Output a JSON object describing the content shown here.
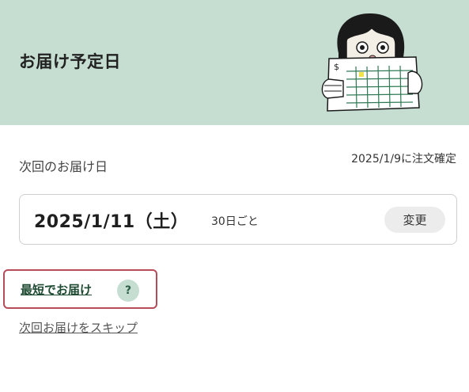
{
  "header": {
    "title": "お届け予定日"
  },
  "next_delivery": {
    "label": "次回のお届け日",
    "confirm_text": "2025/1/9に注文確定",
    "date": "2025/1/11（土）",
    "frequency": "30日ごと",
    "change_label": "変更"
  },
  "actions": {
    "fastest_label": "最短でお届け",
    "help_symbol": "?",
    "skip_label": "次回お届けをスキップ"
  },
  "colors": {
    "header_bg": "#c5ded1",
    "highlight_border": "#b64b5a",
    "link_green": "#1f4b33"
  },
  "icons": {
    "illustration": "person-holding-calendar-illustration",
    "help": "question-mark-icon"
  }
}
